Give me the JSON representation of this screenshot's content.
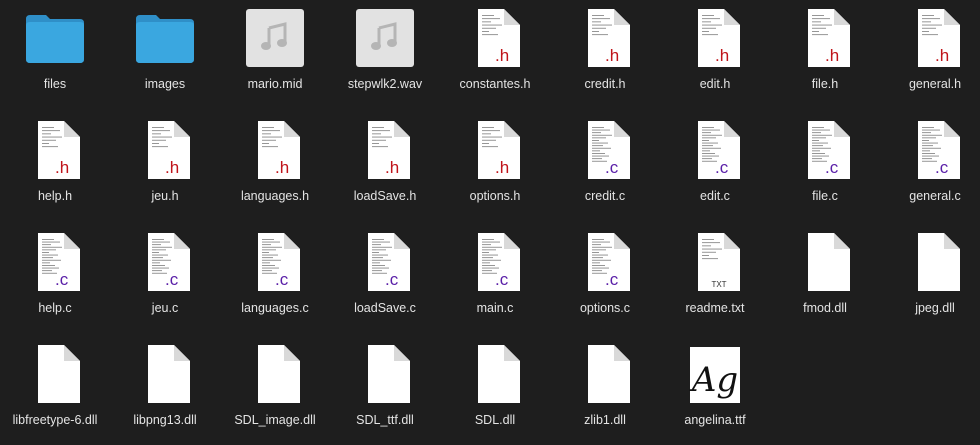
{
  "window": {
    "view": "icon-grid"
  },
  "colors": {
    "background": "#1e1e1e",
    "label": "#e4e4e4",
    "folder": "#3aa7e0",
    "h_badge": "#c0141a",
    "c_badge": "#5a1fa8",
    "doc": "#ffffff",
    "doc_fold": "#d9d9d9"
  },
  "files": [
    {
      "name": "files",
      "kind": "folder",
      "icon": "folder-icon"
    },
    {
      "name": "images",
      "kind": "folder",
      "icon": "folder-icon"
    },
    {
      "name": "mario.mid",
      "kind": "audio",
      "icon": "music-note-icon"
    },
    {
      "name": "stepwlk2.wav",
      "kind": "audio",
      "icon": "music-note-icon"
    },
    {
      "name": "constantes.h",
      "kind": "h",
      "badge": ".h",
      "icon": "header-file-icon"
    },
    {
      "name": "credit.h",
      "kind": "h",
      "badge": ".h",
      "icon": "header-file-icon"
    },
    {
      "name": "edit.h",
      "kind": "h",
      "badge": ".h",
      "icon": "header-file-icon"
    },
    {
      "name": "file.h",
      "kind": "h",
      "badge": ".h",
      "icon": "header-file-icon"
    },
    {
      "name": "general.h",
      "kind": "h",
      "badge": ".h",
      "icon": "header-file-icon"
    },
    {
      "name": "help.h",
      "kind": "h",
      "badge": ".h",
      "icon": "header-file-icon"
    },
    {
      "name": "jeu.h",
      "kind": "h",
      "badge": ".h",
      "icon": "header-file-icon"
    },
    {
      "name": "languages.h",
      "kind": "h",
      "badge": ".h",
      "icon": "header-file-icon"
    },
    {
      "name": "loadSave.h",
      "kind": "h",
      "badge": ".h",
      "icon": "header-file-icon"
    },
    {
      "name": "options.h",
      "kind": "h",
      "badge": ".h",
      "icon": "header-file-icon"
    },
    {
      "name": "credit.c",
      "kind": "c",
      "badge": ".c",
      "icon": "c-source-file-icon"
    },
    {
      "name": "edit.c",
      "kind": "c",
      "badge": ".c",
      "icon": "c-source-file-icon"
    },
    {
      "name": "file.c",
      "kind": "c",
      "badge": ".c",
      "icon": "c-source-file-icon"
    },
    {
      "name": "general.c",
      "kind": "c",
      "badge": ".c",
      "icon": "c-source-file-icon"
    },
    {
      "name": "help.c",
      "kind": "c",
      "badge": ".c",
      "icon": "c-source-file-icon"
    },
    {
      "name": "jeu.c",
      "kind": "c",
      "badge": ".c",
      "icon": "c-source-file-icon"
    },
    {
      "name": "languages.c",
      "kind": "c",
      "badge": ".c",
      "icon": "c-source-file-icon"
    },
    {
      "name": "loadSave.c",
      "kind": "c",
      "badge": ".c",
      "icon": "c-source-file-icon"
    },
    {
      "name": "main.c",
      "kind": "c",
      "badge": ".c",
      "icon": "c-source-file-icon"
    },
    {
      "name": "options.c",
      "kind": "c",
      "badge": ".c",
      "icon": "c-source-file-icon"
    },
    {
      "name": "readme.txt",
      "kind": "txt",
      "badge": "TXT",
      "icon": "text-file-icon"
    },
    {
      "name": "fmod.dll",
      "kind": "blank",
      "icon": "blank-document-icon"
    },
    {
      "name": "jpeg.dll",
      "kind": "blank",
      "icon": "blank-document-icon"
    },
    {
      "name": "libfreetype-6.dll",
      "kind": "blank",
      "icon": "blank-document-icon"
    },
    {
      "name": "libpng13.dll",
      "kind": "blank",
      "icon": "blank-document-icon"
    },
    {
      "name": "SDL_image.dll",
      "kind": "blank",
      "icon": "blank-document-icon"
    },
    {
      "name": "SDL_ttf.dll",
      "kind": "blank",
      "icon": "blank-document-icon"
    },
    {
      "name": "SDL.dll",
      "kind": "blank",
      "icon": "blank-document-icon"
    },
    {
      "name": "zlib1.dll",
      "kind": "blank",
      "icon": "blank-document-icon"
    },
    {
      "name": "angelina.ttf",
      "kind": "font",
      "badge": "Ag",
      "icon": "font-preview-icon"
    }
  ]
}
